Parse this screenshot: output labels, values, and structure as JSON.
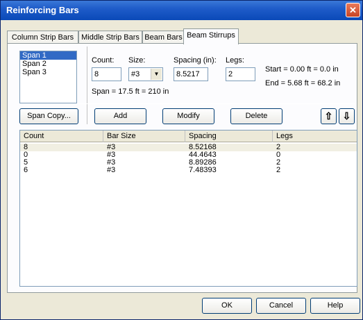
{
  "window": {
    "title": "Reinforcing Bars",
    "close_label": "✕"
  },
  "tabs": [
    {
      "label": "Column Strip Bars",
      "active": false
    },
    {
      "label": "Middle Strip Bars",
      "active": false
    },
    {
      "label": "Beam Bars",
      "active": false
    },
    {
      "label": "Beam Stirrups",
      "active": true
    }
  ],
  "spans": [
    "Span 1",
    "Span 2",
    "Span 3"
  ],
  "form": {
    "count_label": "Count:",
    "count_value": "8",
    "size_label": "Size:",
    "size_value": "#3",
    "spacing_label": "Spacing (in):",
    "spacing_value": "8.5217",
    "legs_label": "Legs:",
    "legs_value": "2",
    "start_text": "Start = 0.00 ft = 0.0 in",
    "end_text": "End = 5.68 ft = 68.2 in",
    "span_text": "Span = 17.5 ft = 210 in"
  },
  "buttons": {
    "span_copy": "Span Copy...",
    "add": "Add",
    "modify": "Modify",
    "delete": "Delete",
    "up_arrow": "⇧",
    "down_arrow": "⇩",
    "ok": "OK",
    "cancel": "Cancel",
    "help": "Help"
  },
  "table": {
    "headers": [
      "Count",
      "Bar Size",
      "Spacing",
      "Legs"
    ],
    "rows": [
      [
        "8",
        "#3",
        "8.52168",
        "2"
      ],
      [
        "0",
        "#3",
        "44.4643",
        "0"
      ],
      [
        "5",
        "#3",
        "8.89286",
        "2"
      ],
      [
        "6",
        "#3",
        "7.48393",
        "2"
      ]
    ]
  },
  "colors": {
    "title_bar": "#0a49b8",
    "selection": "#316ac5",
    "dialog_bg": "#ece9d8"
  }
}
